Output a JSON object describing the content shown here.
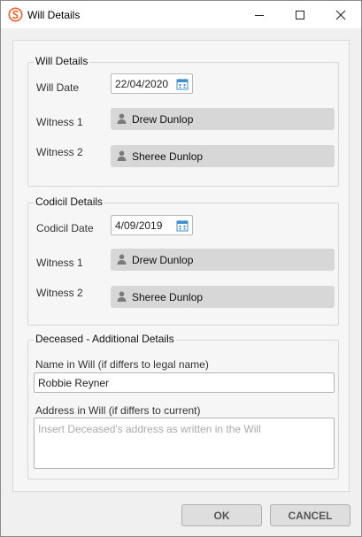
{
  "window": {
    "title": "Will Details"
  },
  "will": {
    "title": "Will Details",
    "date_label": "Will Date",
    "date_value": "22/04/2020",
    "witness1_label": "Witness 1",
    "witness1": "Drew Dunlop",
    "witness2_label": "Witness 2",
    "witness2": "Sheree Dunlop"
  },
  "codicil": {
    "title": "Codicil Details",
    "date_label": "Codicil Date",
    "date_value": "4/09/2019",
    "witness1_label": "Witness 1",
    "witness1": "Drew Dunlop",
    "witness2_label": "Witness 2",
    "witness2": "Sheree Dunlop"
  },
  "deceased": {
    "title": "Deceased - Additional Details",
    "name_label": "Name in Will (if differs to legal name)",
    "name_value": "Robbie Reyner",
    "address_label": "Address in Will (if differs to current)",
    "address_placeholder": "Insert Deceased's address as written in the Will"
  },
  "buttons": {
    "ok": "OK",
    "cancel": "CANCEL"
  },
  "colors": {
    "accent": "#e8612c",
    "calendar_icon": "#3c8fd0"
  },
  "icons": [
    "app-logo-icon",
    "minimize-icon",
    "maximize-icon",
    "close-icon",
    "calendar-icon",
    "person-icon"
  ]
}
